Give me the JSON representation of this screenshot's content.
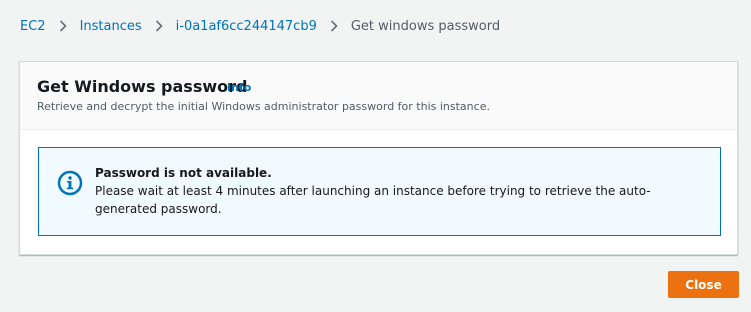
{
  "breadcrumb": {
    "items": [
      {
        "label": "EC2"
      },
      {
        "label": "Instances"
      },
      {
        "label": "i-0a1af6cc244147cb9"
      },
      {
        "label": "Get windows password"
      }
    ]
  },
  "panel": {
    "title": "Get Windows password",
    "info_label": "Info",
    "description": "Retrieve and decrypt the initial Windows administrator password for this instance."
  },
  "alert": {
    "icon": "info-circle-icon",
    "title": "Password is not available.",
    "message": "Please wait at least 4 minutes after launching an instance before trying to retrieve the auto-generated password."
  },
  "footer": {
    "close_label": "Close"
  },
  "colors": {
    "link": "#0073bb",
    "primary_button": "#ec7211",
    "alert_bg": "#f1faff",
    "alert_border": "#0073bb",
    "page_bg": "#f2f3f3"
  }
}
